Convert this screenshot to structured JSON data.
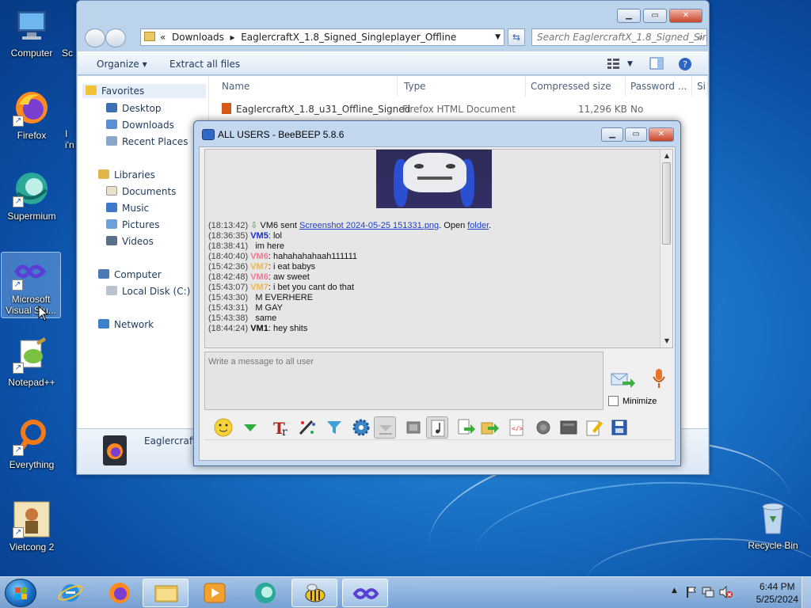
{
  "desktop": {
    "icons": [
      {
        "label": "Computer"
      },
      {
        "label": "Firefox"
      },
      {
        "label": "Supermium"
      },
      {
        "label": "Microsoft Visual Stu..."
      },
      {
        "label": "Notepad++"
      },
      {
        "label": "Everything"
      },
      {
        "label": "Vietcong 2"
      },
      {
        "label": "Recycle Bin"
      }
    ],
    "partial_labels": [
      "Sc",
      "I",
      "i'n"
    ]
  },
  "explorer": {
    "breadcrumb": {
      "prefix": "«",
      "part1": "Downloads",
      "sep": "▸",
      "part2": "EaglercraftX_1.8_Signed_Singleplayer_Offline"
    },
    "search_placeholder": "Search EaglercraftX_1.8_Signed_Single...",
    "toolbar": {
      "organize": "Organize",
      "extract": "Extract all files"
    },
    "nav": {
      "favorites": "Favorites",
      "desktop": "Desktop",
      "downloads": "Downloads",
      "recent": "Recent Places",
      "libraries": "Libraries",
      "documents": "Documents",
      "music": "Music",
      "pictures": "Pictures",
      "videos": "Videos",
      "computer": "Computer",
      "local_disk": "Local Disk (C:)",
      "network": "Network"
    },
    "columns": {
      "name": "Name",
      "type": "Type",
      "compressed": "Compressed size",
      "password": "Password ...",
      "size": "Si"
    },
    "file": {
      "name": "EaglercraftX_1.8_u31_Offline_Signed",
      "type": "Firefox HTML Document",
      "compressed": "11,296 KB",
      "password": "No"
    },
    "details_name": "Eaglercraft"
  },
  "beebeep": {
    "title": "ALL USERS - BeeBEEP 5.8.6",
    "messages": [
      {
        "time": "(18:13:42)",
        "user": "",
        "text": "VM6 sent ",
        "link": "Screenshot 2024-05-25 151331.png",
        "after": ". Open ",
        "link2": "folder",
        "end": "."
      },
      {
        "time": "(18:36:35)",
        "user": "VM5",
        "user_color": "#1a2fd0",
        "text": ": lol"
      },
      {
        "time": "(18:38:41)",
        "user": "",
        "text": "   im here"
      },
      {
        "time": "(18:40:40)",
        "user": "VM6",
        "user_color": "#f07890",
        "text": ": hahahahahaah111111"
      },
      {
        "time": "(15:42:36)",
        "user": "VM7",
        "user_color": "#f0b848",
        "text": ": i eat babys"
      },
      {
        "time": "(18:42:48)",
        "user": "VM6",
        "user_color": "#f07890",
        "text": ": aw sweet"
      },
      {
        "time": "(15:43:07)",
        "user": "VM7",
        "user_color": "#f0b848",
        "text": ": i bet you cant do that"
      },
      {
        "time": "(15:43:30)",
        "user": "",
        "text": "   M EVERHERE"
      },
      {
        "time": "(15:43:31)",
        "user": "",
        "text": "   M GAY"
      },
      {
        "time": "(15:43:38)",
        "user": "",
        "text": "   same"
      },
      {
        "time": "(18:44:24)",
        "user": "VM1",
        "user_color": "#111111",
        "text": ": hey shits"
      }
    ],
    "input_placeholder": "Write a message to all user",
    "minimize_label": "Minimize"
  },
  "taskbar": {
    "time": "6:44 PM",
    "date": "5/25/2024"
  },
  "colors": {
    "desktop_blue": "#1b74c9",
    "window_frame": "#bcd3ec",
    "close_red": "#c8452b"
  }
}
